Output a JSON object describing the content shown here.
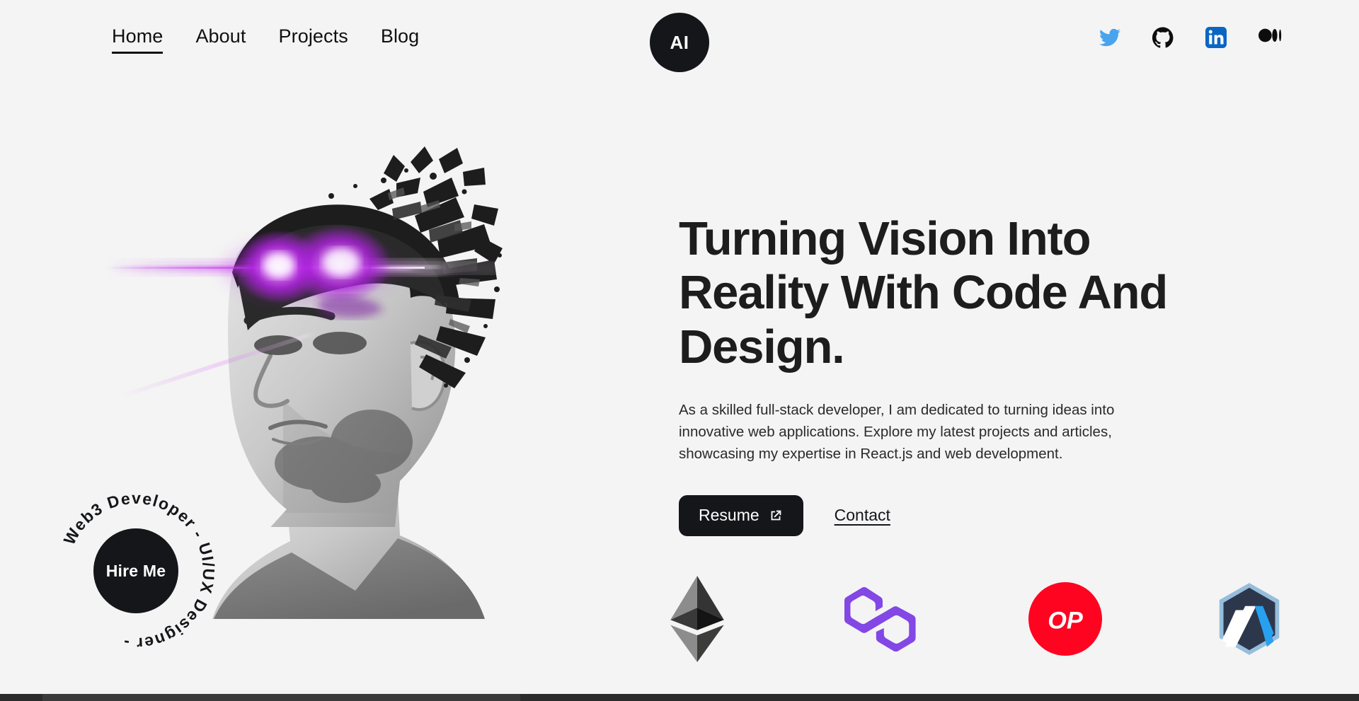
{
  "header": {
    "nav": [
      {
        "label": "Home",
        "active": true
      },
      {
        "label": "About",
        "active": false
      },
      {
        "label": "Projects",
        "active": false
      },
      {
        "label": "Blog",
        "active": false
      }
    ],
    "logo_text": "AI",
    "socials": [
      {
        "name": "twitter",
        "color": "#4aa3ed"
      },
      {
        "name": "github",
        "color": "#000000"
      },
      {
        "name": "linkedin",
        "color": "#0a66c2"
      },
      {
        "name": "medium",
        "color": "#000000"
      }
    ]
  },
  "hero": {
    "portrait_alt": "grayscale-portrait-dispersion-purple-laser-eyes",
    "headline": "Turning Vision Into Reality With Code And Design.",
    "subtext": "As a skilled full-stack developer, I am dedicated to turning ideas into innovative web applications. Explore my latest projects and articles, showcasing my expertise in React.js and web development.",
    "resume_label": "Resume",
    "contact_label": "Contact"
  },
  "badge": {
    "center_label": "Hire Me",
    "ring_text": "Web3 Developer - UI/UX Designer - "
  },
  "chains": [
    {
      "name": "ethereum",
      "color": "#3c3c3d"
    },
    {
      "name": "polygon",
      "color": "#8247e5"
    },
    {
      "name": "optimism",
      "color": "#ff0420",
      "label": "OP"
    },
    {
      "name": "arbitrum",
      "color": "#2d374b"
    }
  ],
  "theme": {
    "background": "#f4f4f4",
    "ink": "#15161a",
    "accent_purple": "#b024e0"
  }
}
